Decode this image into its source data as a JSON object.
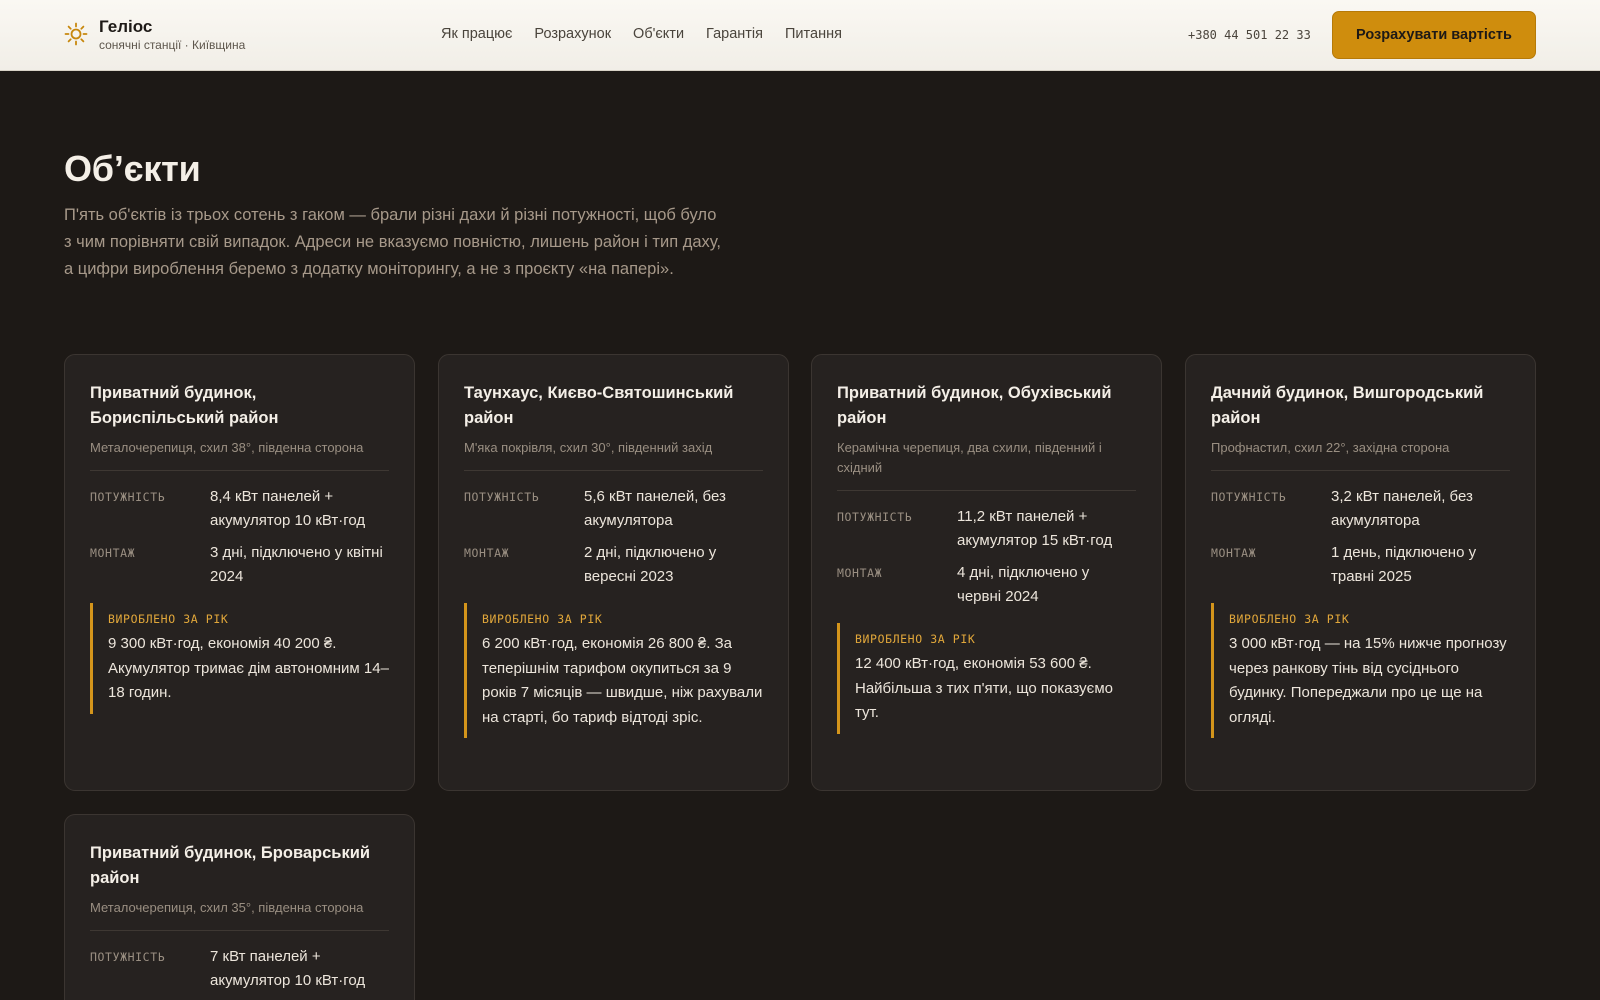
{
  "header": {
    "brand": "Геліос",
    "tagline": "сонячні станції · Київщина",
    "nav": [
      "Як працює",
      "Розрахунок",
      "Об'єкти",
      "Гарантія",
      "Питання"
    ],
    "phone": "+380 44 501 22 33",
    "cta": "Розрахувати вартість"
  },
  "main": {
    "title": "Об’єкти",
    "intro": "П'ять об'єктів із трьох сотень з гаком — брали різні дахи й різні потужності, щоб було з чим порівняти свій випадок. Адреси не вказуємо повністю, лишень район і тип даху, а цифри вироблення беремо з додатку моніторингу, а не з проєкту «на папері»."
  },
  "labels": {
    "power": "ПОТУЖНІСТЬ",
    "install": "МОНТАЖ",
    "produced": "ВИРОБЛЕНО ЗА РІК"
  },
  "projects": [
    {
      "title": "Приватний будинок, Бориспільський район",
      "meta": "Металочерепиця, схил 38°, південна сторона",
      "power": "8,4 кВт панелей + акумулятор 10 кВт·год",
      "install": "3 дні, підключено у квітні 2024",
      "result": "9 300 кВт·год, економія 40 200 ₴. Акумулятор тримає дім автономним 14–18 годин."
    },
    {
      "title": "Таунхаус, Києво-Святошинський район",
      "meta": "М'яка покрівля, схил 30°, південний захід",
      "power": "5,6 кВт панелей, без акумулятора",
      "install": "2 дні, підключено у вересні 2023",
      "result": "6 200 кВт·год, економія 26 800 ₴. За теперішнім тарифом окупиться за 9 років 7 місяців — швидше, ніж рахували на старті, бо тариф відтоді зріс."
    },
    {
      "title": "Приватний будинок, Обухівський район",
      "meta": "Керамічна черепиця, два схили, південний і східний",
      "power": "11,2 кВт панелей + акумулятор 15 кВт·год",
      "install": "4 дні, підключено у червні 2024",
      "result": "12 400 кВт·год, економія 53 600 ₴. Найбільша з тих п'яти, що показуємо тут."
    },
    {
      "title": "Дачний будинок, Вишгородський район",
      "meta": "Профнастил, схил 22°, західна сторона",
      "power": "3,2 кВт панелей, без акумулятора",
      "install": "1 день, підключено у травні 2025",
      "result": "3 000 кВт·год — на 15% нижче прогнозу через ранкову тінь від сусіднього будинку. Попереджали про це ще на огляді."
    },
    {
      "title": "Приватний будинок, Броварський район",
      "meta": "Металочерепиця, схил 35°, південна сторона",
      "power": "7 кВт панелей + акумулятор 10 кВт·год",
      "install": "",
      "result": ""
    }
  ],
  "colors": {
    "accent": "#cf8d0d",
    "background": "#1d1916",
    "card": "#262220"
  },
  "icons": {
    "logo": "sun-icon"
  }
}
